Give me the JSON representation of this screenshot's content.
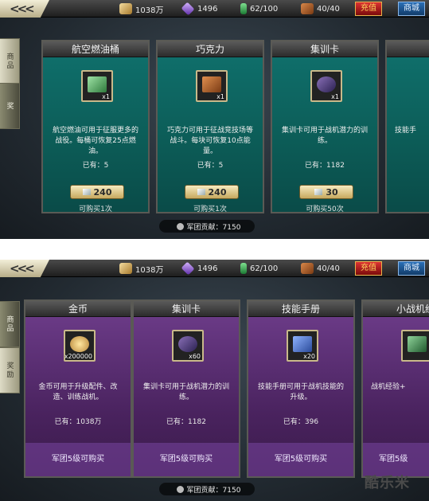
{
  "screens": [
    {
      "topbar": {
        "back_label": "<<<",
        "gold": "1038万",
        "gems": "1496",
        "fuel": "62/100",
        "chocolate": "40/40",
        "recharge_label": "充值",
        "shop_label": "商城"
      },
      "side_tabs": [
        "商品",
        "奖"
      ],
      "cards": [
        {
          "title": "航空燃油桶",
          "qty": "x1",
          "desc": "航空燃油可用于征服更多的战役。每桶可恢复25点燃油。",
          "have": "已有：5",
          "price": "240",
          "limit": "可购买1次"
        },
        {
          "title": "巧克力",
          "qty": "x1",
          "desc": "巧克力可用于征战竞技场等战斗。每块可恢复10点能量。",
          "have": "已有：5",
          "price": "240",
          "limit": "可购买1次"
        },
        {
          "title": "集训卡",
          "qty": "x1",
          "desc": "集训卡可用于战机潜力的训练。",
          "have": "已有：1182",
          "price": "30",
          "limit": "可购买50次"
        },
        {
          "title": "",
          "qty": "",
          "desc": "技能手",
          "have": "",
          "price": "",
          "limit": ""
        }
      ],
      "contribution": "军团贡献：7150"
    },
    {
      "topbar": {
        "back_label": "<<<",
        "gold": "1038万",
        "gems": "1496",
        "fuel": "62/100",
        "chocolate": "40/40",
        "recharge_label": "充值",
        "shop_label": "商城"
      },
      "side_tabs": [
        "商品",
        "奖励"
      ],
      "cards": [
        {
          "title": "金币",
          "qty": "x200000",
          "desc": "金币可用于升级配件、改造、训练战机。",
          "have": "已有：1038万",
          "lock": "军团5级可购买"
        },
        {
          "title": "集训卡",
          "qty": "x60",
          "desc": "集训卡可用于战机潜力的训练。",
          "have": "已有：1182",
          "lock": "军团5级可购买"
        },
        {
          "title": "技能手册",
          "qty": "x20",
          "desc": "技能手册可用于战机技能的升级。",
          "have": "已有：396",
          "lock": "军团5级可购买"
        },
        {
          "title": "小战机经",
          "qty": "",
          "desc": "战机经验+",
          "have": "",
          "lock": "军团5级"
        }
      ],
      "contribution": "军团贡献：7150"
    }
  ],
  "watermark": "酷乐米"
}
